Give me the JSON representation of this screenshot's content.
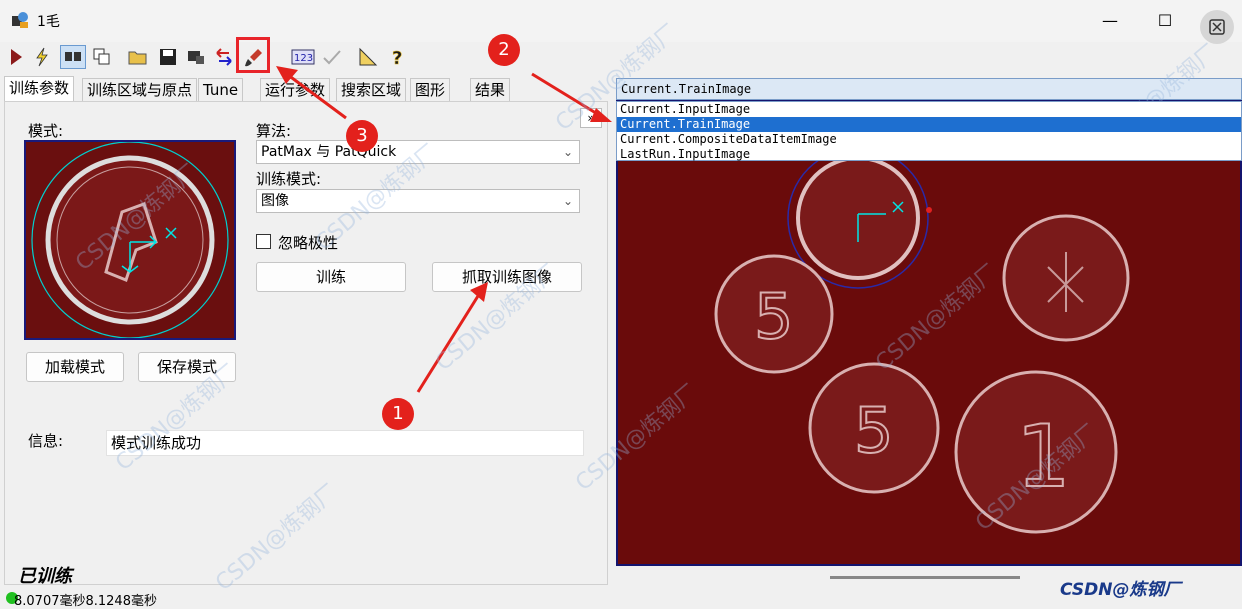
{
  "window": {
    "title": "1毛",
    "minimize": "—",
    "maximize": "☐",
    "close": "✕"
  },
  "tabs": [
    "训练参数",
    "训练区域与原点",
    "Tune",
    "运行参数",
    "搜索区域",
    "图形",
    "结果"
  ],
  "left": {
    "model_label": "模式:",
    "algorithm_label": "算法:",
    "algorithm_value": "PatMax 与 PatQuick",
    "train_mode_label": "训练模式:",
    "train_mode_value": "图像",
    "ignore_polarity": "忽略极性",
    "train_button": "训练",
    "grab_button": "抓取训练图像",
    "load_button": "加载模式",
    "save_button": "保存模式",
    "info_label": "信息:",
    "info_value": "模式训练成功",
    "trained": "已训练",
    "status": "8.0707毫秒8.1248毫秒"
  },
  "right": {
    "combo_value": "Current.TrainImage",
    "options": [
      "Current.InputImage",
      "Current.TrainImage",
      "Current.CompositeDataItemImage",
      "LastRun.InputImage"
    ],
    "selected_option": "Current.TrainImage"
  },
  "callouts": [
    "1",
    "2",
    "3"
  ],
  "watermark": "CSDN@炼钢厂",
  "colors": {
    "image_bg": "#6a0b0b",
    "highlight": "#1e6fd0",
    "callout": "#e3211c",
    "graphics": "#00e5e5"
  }
}
